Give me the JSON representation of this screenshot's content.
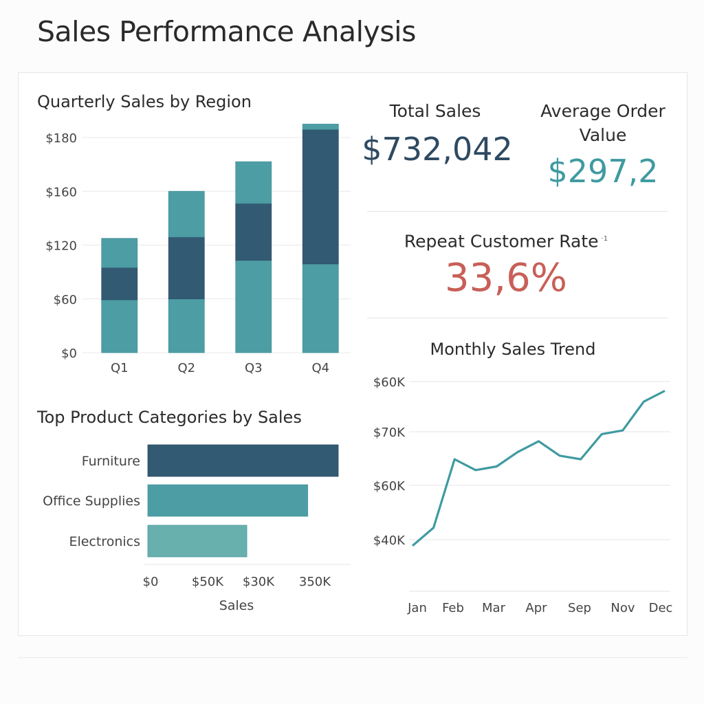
{
  "page_title": "Sales Performance Analysis",
  "kpis": {
    "total_sales": {
      "label": "Total Sales",
      "value": "$732,042"
    },
    "avg_order": {
      "label": "Average Order Value",
      "value": "$297,2"
    },
    "repeat_rate": {
      "label": "Repeat Customer Rate",
      "footnote": "·1",
      "value": "33,6%"
    }
  },
  "colors": {
    "teal": "#4d9ea4",
    "navy": "#335a73",
    "light_teal": "#68b0ad",
    "line": "#3f9aa1",
    "total_value": "#2e4a62",
    "avg_value": "#3f9aa1",
    "rate_value": "#c85f58"
  },
  "chart_data": [
    {
      "id": "quarterly",
      "type": "bar",
      "stacked": true,
      "title": "Quarterly Sales by Region",
      "categories": [
        "Q1",
        "Q2",
        "Q3",
        "Q4"
      ],
      "y_ticks": [
        "$0",
        "$60",
        "$120",
        "$160",
        "$180"
      ],
      "series": [
        {
          "values": [
            59,
            60,
            103,
            99
          ]
        },
        {
          "values": [
            36,
            66,
            48,
            84
          ]
        },
        {
          "values": [
            30,
            34,
            20,
            22
          ]
        }
      ],
      "grid": true
    },
    {
      "id": "categories",
      "type": "bar",
      "orientation": "horizontal",
      "title": "Top Product Categories by Sales",
      "categories": [
        "Furniture",
        "Office Supplies",
        "Electronics"
      ],
      "values": [
        100,
        84,
        52
      ],
      "x_ticks": [
        "$0",
        "$50K",
        "$30K",
        "350K"
      ],
      "xlabel": "Sales"
    },
    {
      "id": "monthly",
      "type": "line",
      "title": "Monthly Sales Trend",
      "x_ticks": [
        "Jan",
        "Feb",
        "Mar",
        "Apr",
        "Sep",
        "Nov",
        "Dec"
      ],
      "y_ticks": [
        "$60K",
        "$70K",
        "$60K",
        "$40K"
      ],
      "values": [
        35,
        40,
        59,
        56,
        57,
        61,
        64,
        60,
        59,
        66,
        67,
        75,
        78
      ],
      "grid": true
    }
  ]
}
